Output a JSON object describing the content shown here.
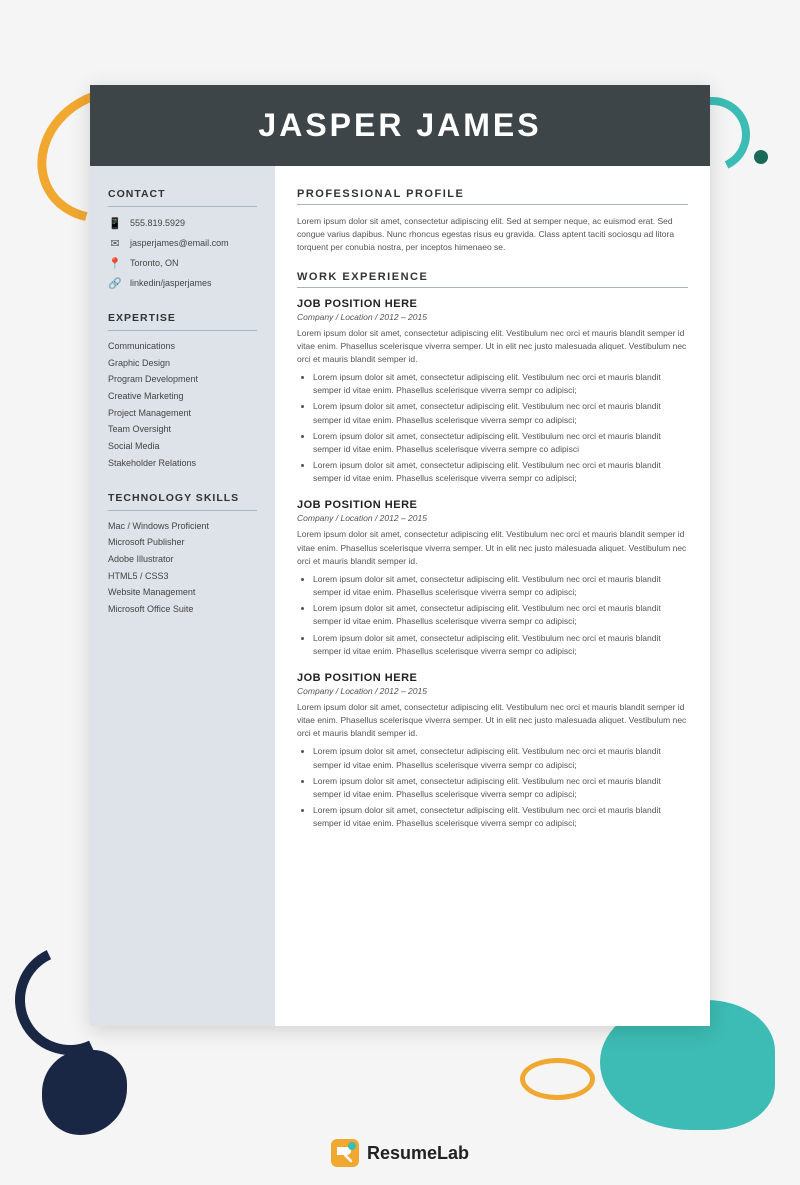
{
  "background": {
    "color": "#f0f0f0"
  },
  "header": {
    "name": "JASPER JAMES"
  },
  "sidebar": {
    "contact_label": "CONTACT",
    "phone": "555.819.5929",
    "email": "jasperjames@email.com",
    "location": "Toronto, ON",
    "linkedin": "linkedin/jasperjames",
    "expertise_label": "EXPERTISE",
    "expertise_items": [
      "Communications",
      "Graphic Design",
      "Program Development",
      "Creative Marketing",
      "Project Management",
      "Team Oversight",
      "Social Media",
      "Stakeholder Relations"
    ],
    "tech_label": "TECHNOLOGY SKILLS",
    "tech_items": [
      "Mac / Windows Proficient",
      "Microsoft Publisher",
      "Adobe Illustrator",
      "HTML5 / CSS3",
      "Website Management",
      "Microsoft Office Suite"
    ]
  },
  "main": {
    "profile_title": "PROFESSIONAL PROFILE",
    "profile_text": "Lorem ipsum dolor sit amet, consectetur adipiscing elit. Sed at semper neque, ac euismod erat. Sed congue varius dapibus. Nunc rhoncus egestas risus eu gravida. Class aptent taciti sociosqu ad litora torquent per conubia nostra, per inceptos himenaeo se.",
    "work_title": "WORK EXPERIENCE",
    "jobs": [
      {
        "title": "JOB POSITION HERE",
        "company": "Company / Location / 2012 – 2015",
        "description": "Lorem ipsum dolor sit amet, consectetur adipiscing elit. Vestibulum nec orci et mauris blandit semper id vitae enim. Phasellus scelerisque viverra semper. Ut in elit nec justo malesuada aliquet. Vestibulum nec orci et mauris blandit semper id.",
        "bullets": [
          "Lorem ipsum dolor sit amet, consectetur adipiscing elit. Vestibulum nec orci et mauris blandit semper id vitae enim. Phasellus scelerisque viverra sempr co adipisci;",
          "Lorem ipsum dolor sit amet, consectetur adipiscing elit. Vestibulum nec orci et mauris blandit semper id vitae enim. Phasellus scelerisque viverra sempr co adipisci;",
          "Lorem ipsum dolor sit amet, consectetur adipiscing elit. Vestibulum nec orci et mauris blandit semper id vitae enim. Phasellus scelerisque viverra sempre co adipisci",
          "Lorem ipsum dolor sit amet, consectetur adipiscing elit. Vestibulum nec orci et mauris blandit semper id vitae enim. Phasellus scelerisque viverra sempr co adipisci;"
        ]
      },
      {
        "title": "JOB POSITION HERE",
        "company": "Company / Location /  2012 – 2015",
        "description": "Lorem ipsum dolor sit amet, consectetur adipiscing elit. Vestibulum nec orci et mauris blandit semper id vitae enim. Phasellus scelerisque viverra semper. Ut in elit nec justo malesuada aliquet. Vestibulum nec orci et mauris blandit semper id.",
        "bullets": [
          "Lorem ipsum dolor sit amet, consectetur adipiscing elit. Vestibulum nec orci et mauris blandit semper id vitae enim. Phasellus scelerisque viverra sempr co adipisci;",
          "Lorem ipsum dolor sit amet, consectetur adipiscing elit. Vestibulum nec orci et mauris blandit semper id vitae enim. Phasellus scelerisque viverra sempr co adipisci;",
          "Lorem ipsum dolor sit amet, consectetur adipiscing elit. Vestibulum nec orci et mauris blandit semper id vitae enim. Phasellus scelerisque viverra sempr co adipisci;"
        ]
      },
      {
        "title": "JOB POSITION HERE",
        "company": "Company / Location / 2012 – 2015",
        "description": "Lorem ipsum dolor sit amet, consectetur adipiscing elit. Vestibulum nec orci et mauris blandit semper id vitae enim. Phasellus scelerisque viverra semper. Ut in elit nec justo malesuada aliquet. Vestibulum nec orci et mauris blandit semper id.",
        "bullets": [
          "Lorem ipsum dolor sit amet, consectetur adipiscing elit. Vestibulum nec orci et mauris blandit semper id vitae enim. Phasellus scelerisque viverra sempr co adipisci;",
          "Lorem ipsum dolor sit amet, consectetur adipiscing elit. Vestibulum nec orci et mauris blandit semper id vitae enim. Phasellus scelerisque viverra sempr co adipisci;",
          "Lorem ipsum dolor sit amet, consectetur adipiscing elit. Vestibulum nec orci et mauris blandit semper id vitae enim. Phasellus scelerisque viverra sempr co adipisci;"
        ]
      }
    ]
  },
  "branding": {
    "name_plain": "Resume",
    "name_bold": "Lab"
  }
}
